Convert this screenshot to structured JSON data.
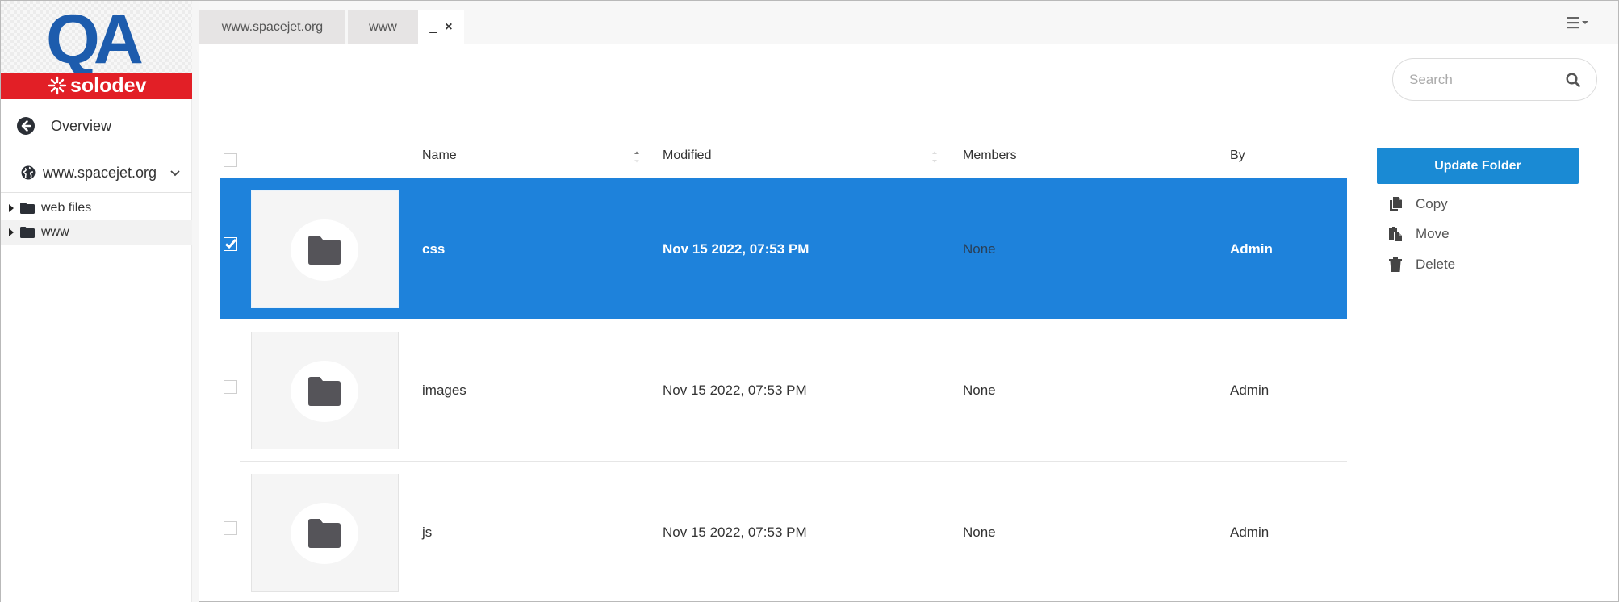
{
  "brand": {
    "logo_text": "QA",
    "logo_subtext": "solodev",
    "colors": {
      "logo_blue": "#1d5cad",
      "logo_red": "#e21f26"
    }
  },
  "sidebar": {
    "back_label": "Overview",
    "back_icon": "arrow-circle-left-icon",
    "site_selector": {
      "value": "www.spacejet.org",
      "icon": "globe-icon"
    },
    "tree": [
      {
        "label": "web files",
        "icon": "folder-icon",
        "active": false
      },
      {
        "label": "www",
        "icon": "folder-icon",
        "active": true
      }
    ]
  },
  "tabs": [
    {
      "label": "www.spacejet.org",
      "active": false
    },
    {
      "label": "www",
      "active": false
    },
    {
      "label": "",
      "minimize_label": "_",
      "close_label": "×",
      "active": true
    }
  ],
  "toolbar": {
    "menu_icon": "hamburger-dropdown-icon"
  },
  "search": {
    "placeholder": "Search",
    "value": ""
  },
  "table": {
    "columns": [
      "Name",
      "Modified",
      "Members",
      "By"
    ],
    "rows": [
      {
        "name": "css",
        "modified": "Nov 15 2022, 07:53 PM",
        "members": "None",
        "by": "Admin",
        "selected": true
      },
      {
        "name": "images",
        "modified": "Nov 15 2022, 07:53 PM",
        "members": "None",
        "by": "Admin",
        "selected": false
      },
      {
        "name": "js",
        "modified": "Nov 15 2022, 07:53 PM",
        "members": "None",
        "by": "Admin",
        "selected": false
      }
    ],
    "selected_color": "#1e82db"
  },
  "actions": {
    "primary_label": "Update Folder",
    "primary_color": "#1a8ad4",
    "items": [
      {
        "label": "Copy",
        "icon": "copy-icon"
      },
      {
        "label": "Move",
        "icon": "move-icon"
      },
      {
        "label": "Delete",
        "icon": "trash-icon"
      }
    ]
  }
}
